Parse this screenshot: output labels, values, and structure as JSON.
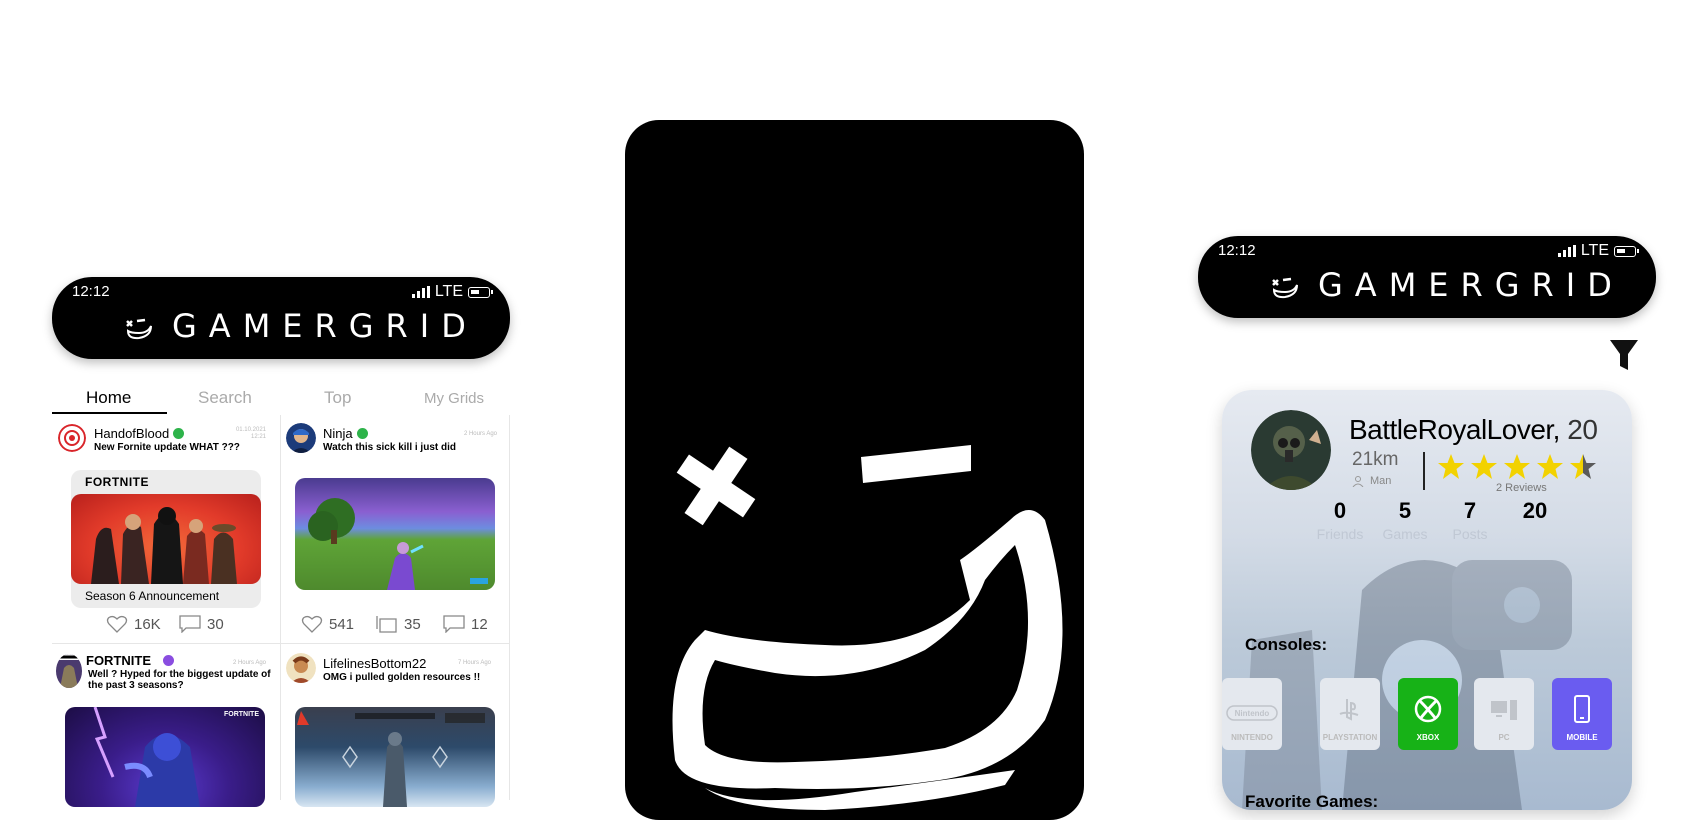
{
  "left_phone": {
    "time": "12:12",
    "network": "LTE",
    "brand": "GAMERGRID",
    "tabs": [
      "Home",
      "Search",
      "Top",
      "My Grids"
    ],
    "posts": [
      {
        "user": "HandofBlood",
        "verified": true,
        "title": "New Fornite update WHAT ???",
        "date": "01.10.2021 12:21",
        "card_header": "FORTNITE",
        "caption": "Season 6 Announcement",
        "likes": "16K",
        "comments": "30"
      },
      {
        "user": "Ninja",
        "verified": true,
        "title": "Watch this sick kill i just did",
        "date": "2 Hours Ago",
        "likes": "541",
        "shares": "35",
        "comments": "12"
      },
      {
        "user": "FORTNITE",
        "verified": true,
        "title": "Well ? Hyped for the biggest update of the past 3 seasons?",
        "date": "2 Hours Ago",
        "thumb_logo": "FORTNITE"
      },
      {
        "user": "LifelinesBottom22",
        "verified": false,
        "title": "OMG i pulled golden resources !!",
        "date": "7 Hours Ago"
      }
    ]
  },
  "right_phone": {
    "time": "12:12",
    "network": "LTE",
    "brand": "GAMERGRID",
    "profile": {
      "name": "BattleRoyalLover,",
      "age": "20",
      "distance": "21km",
      "gender": "Man",
      "rating": 4.5,
      "reviews": "2 Reviews",
      "stats": [
        {
          "value": "0",
          "label": "Friends"
        },
        {
          "value": "5",
          "label": "Games"
        },
        {
          "value": "7",
          "label": "Posts"
        },
        {
          "value": "20",
          "label": ""
        }
      ],
      "consoles_heading": "Consoles:",
      "consoles": [
        {
          "name": "NINTENDO",
          "active": false,
          "color": "#e4e8ee"
        },
        {
          "name": "PLAYSTATION",
          "active": false,
          "color": "#e4e8ee"
        },
        {
          "name": "XBOX",
          "active": true,
          "color": "#17b217"
        },
        {
          "name": "PC",
          "active": false,
          "color": "#e4e8ee"
        },
        {
          "name": "MOBILE",
          "active": true,
          "color": "#6a5cf0"
        }
      ],
      "favorite_heading": "Favorite Games:"
    }
  },
  "colors": {
    "star": "#f2d200",
    "verified": "#2db34a"
  }
}
